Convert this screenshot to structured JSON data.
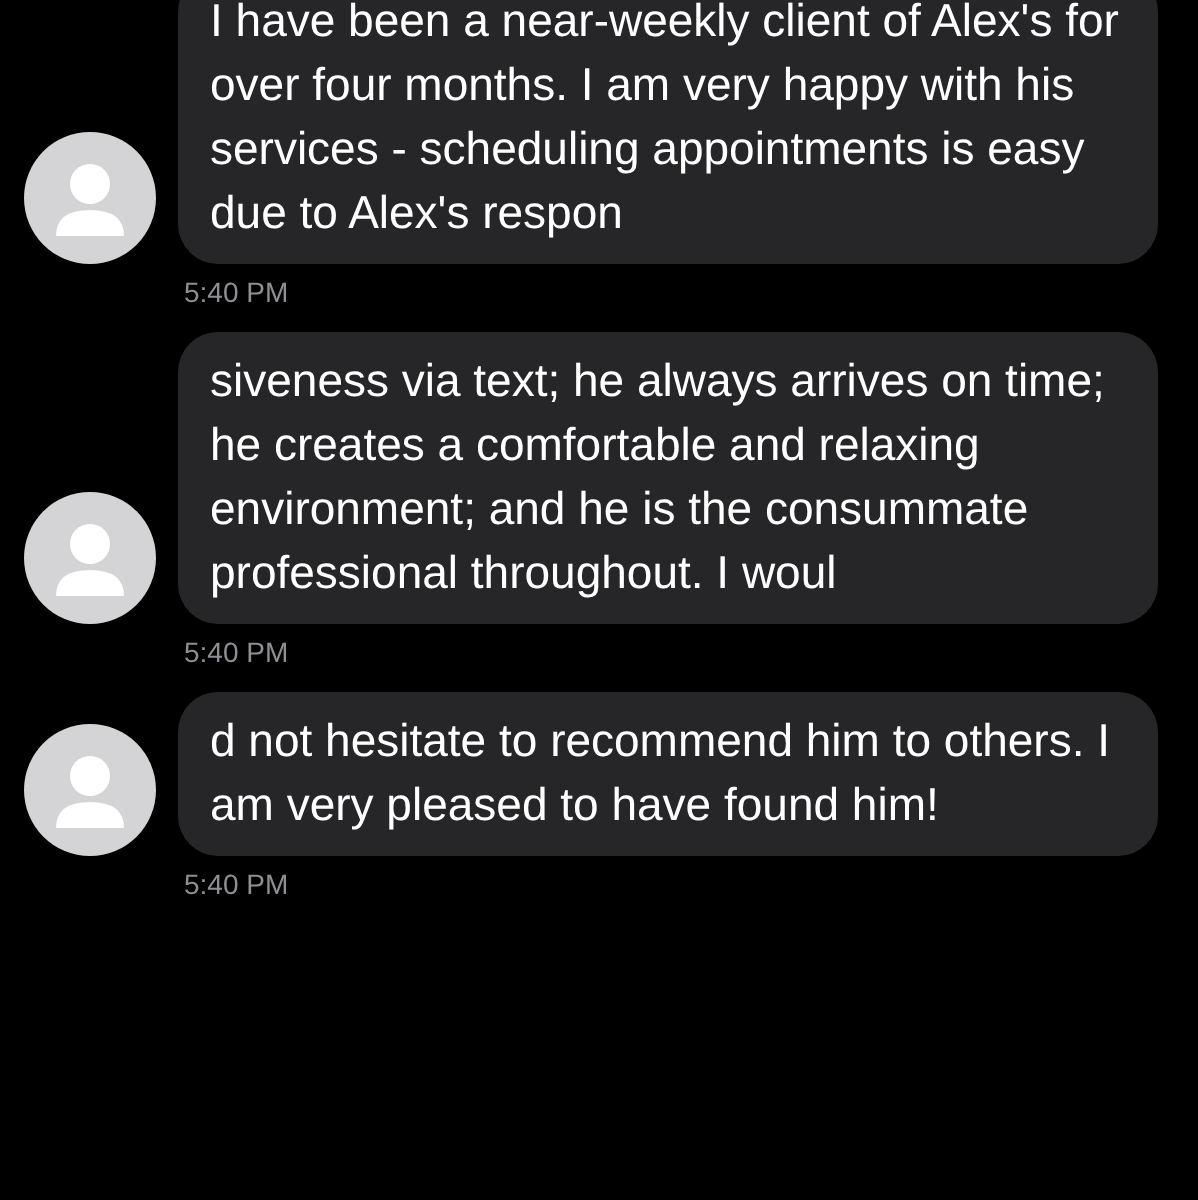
{
  "messages": [
    {
      "text": "I have been a near-weekly client of Alex's for over four months. I am very happy with his services - scheduling appointments is easy due to Alex's respon",
      "time": "5:40 PM"
    },
    {
      "text": "siveness via text; he always arrives on time; he creates a comfortable and relaxing environment; and he is the consummate professional throughout. I woul",
      "time": "5:40 PM"
    },
    {
      "text": "d not hesitate to recommend him to others. I am very pleased to have found him!",
      "time": "5:40 PM"
    }
  ]
}
